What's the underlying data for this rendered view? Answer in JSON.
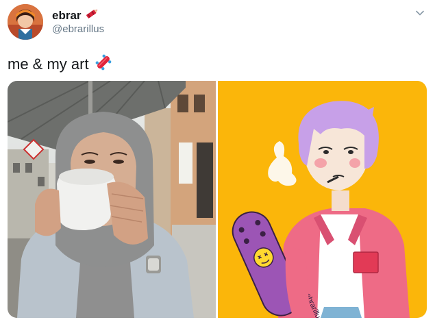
{
  "user": {
    "display_name": "ebrar",
    "handle": "@ebrarillus",
    "name_emoji": "crayon-icon"
  },
  "tweet": {
    "text": "me & my art",
    "text_emoji": "skateboard-icon"
  },
  "media": {
    "left_image": "photo-of-woman-drinking-from-cup",
    "right_image": "illustration-of-skater-with-purple-hair",
    "skateboard_text": "ebrarillus"
  },
  "colors": {
    "illustration_bg": "#fbb60a",
    "jacket": "#ee6b86",
    "hair": "#c7a0e8",
    "handle_text": "#657786"
  }
}
